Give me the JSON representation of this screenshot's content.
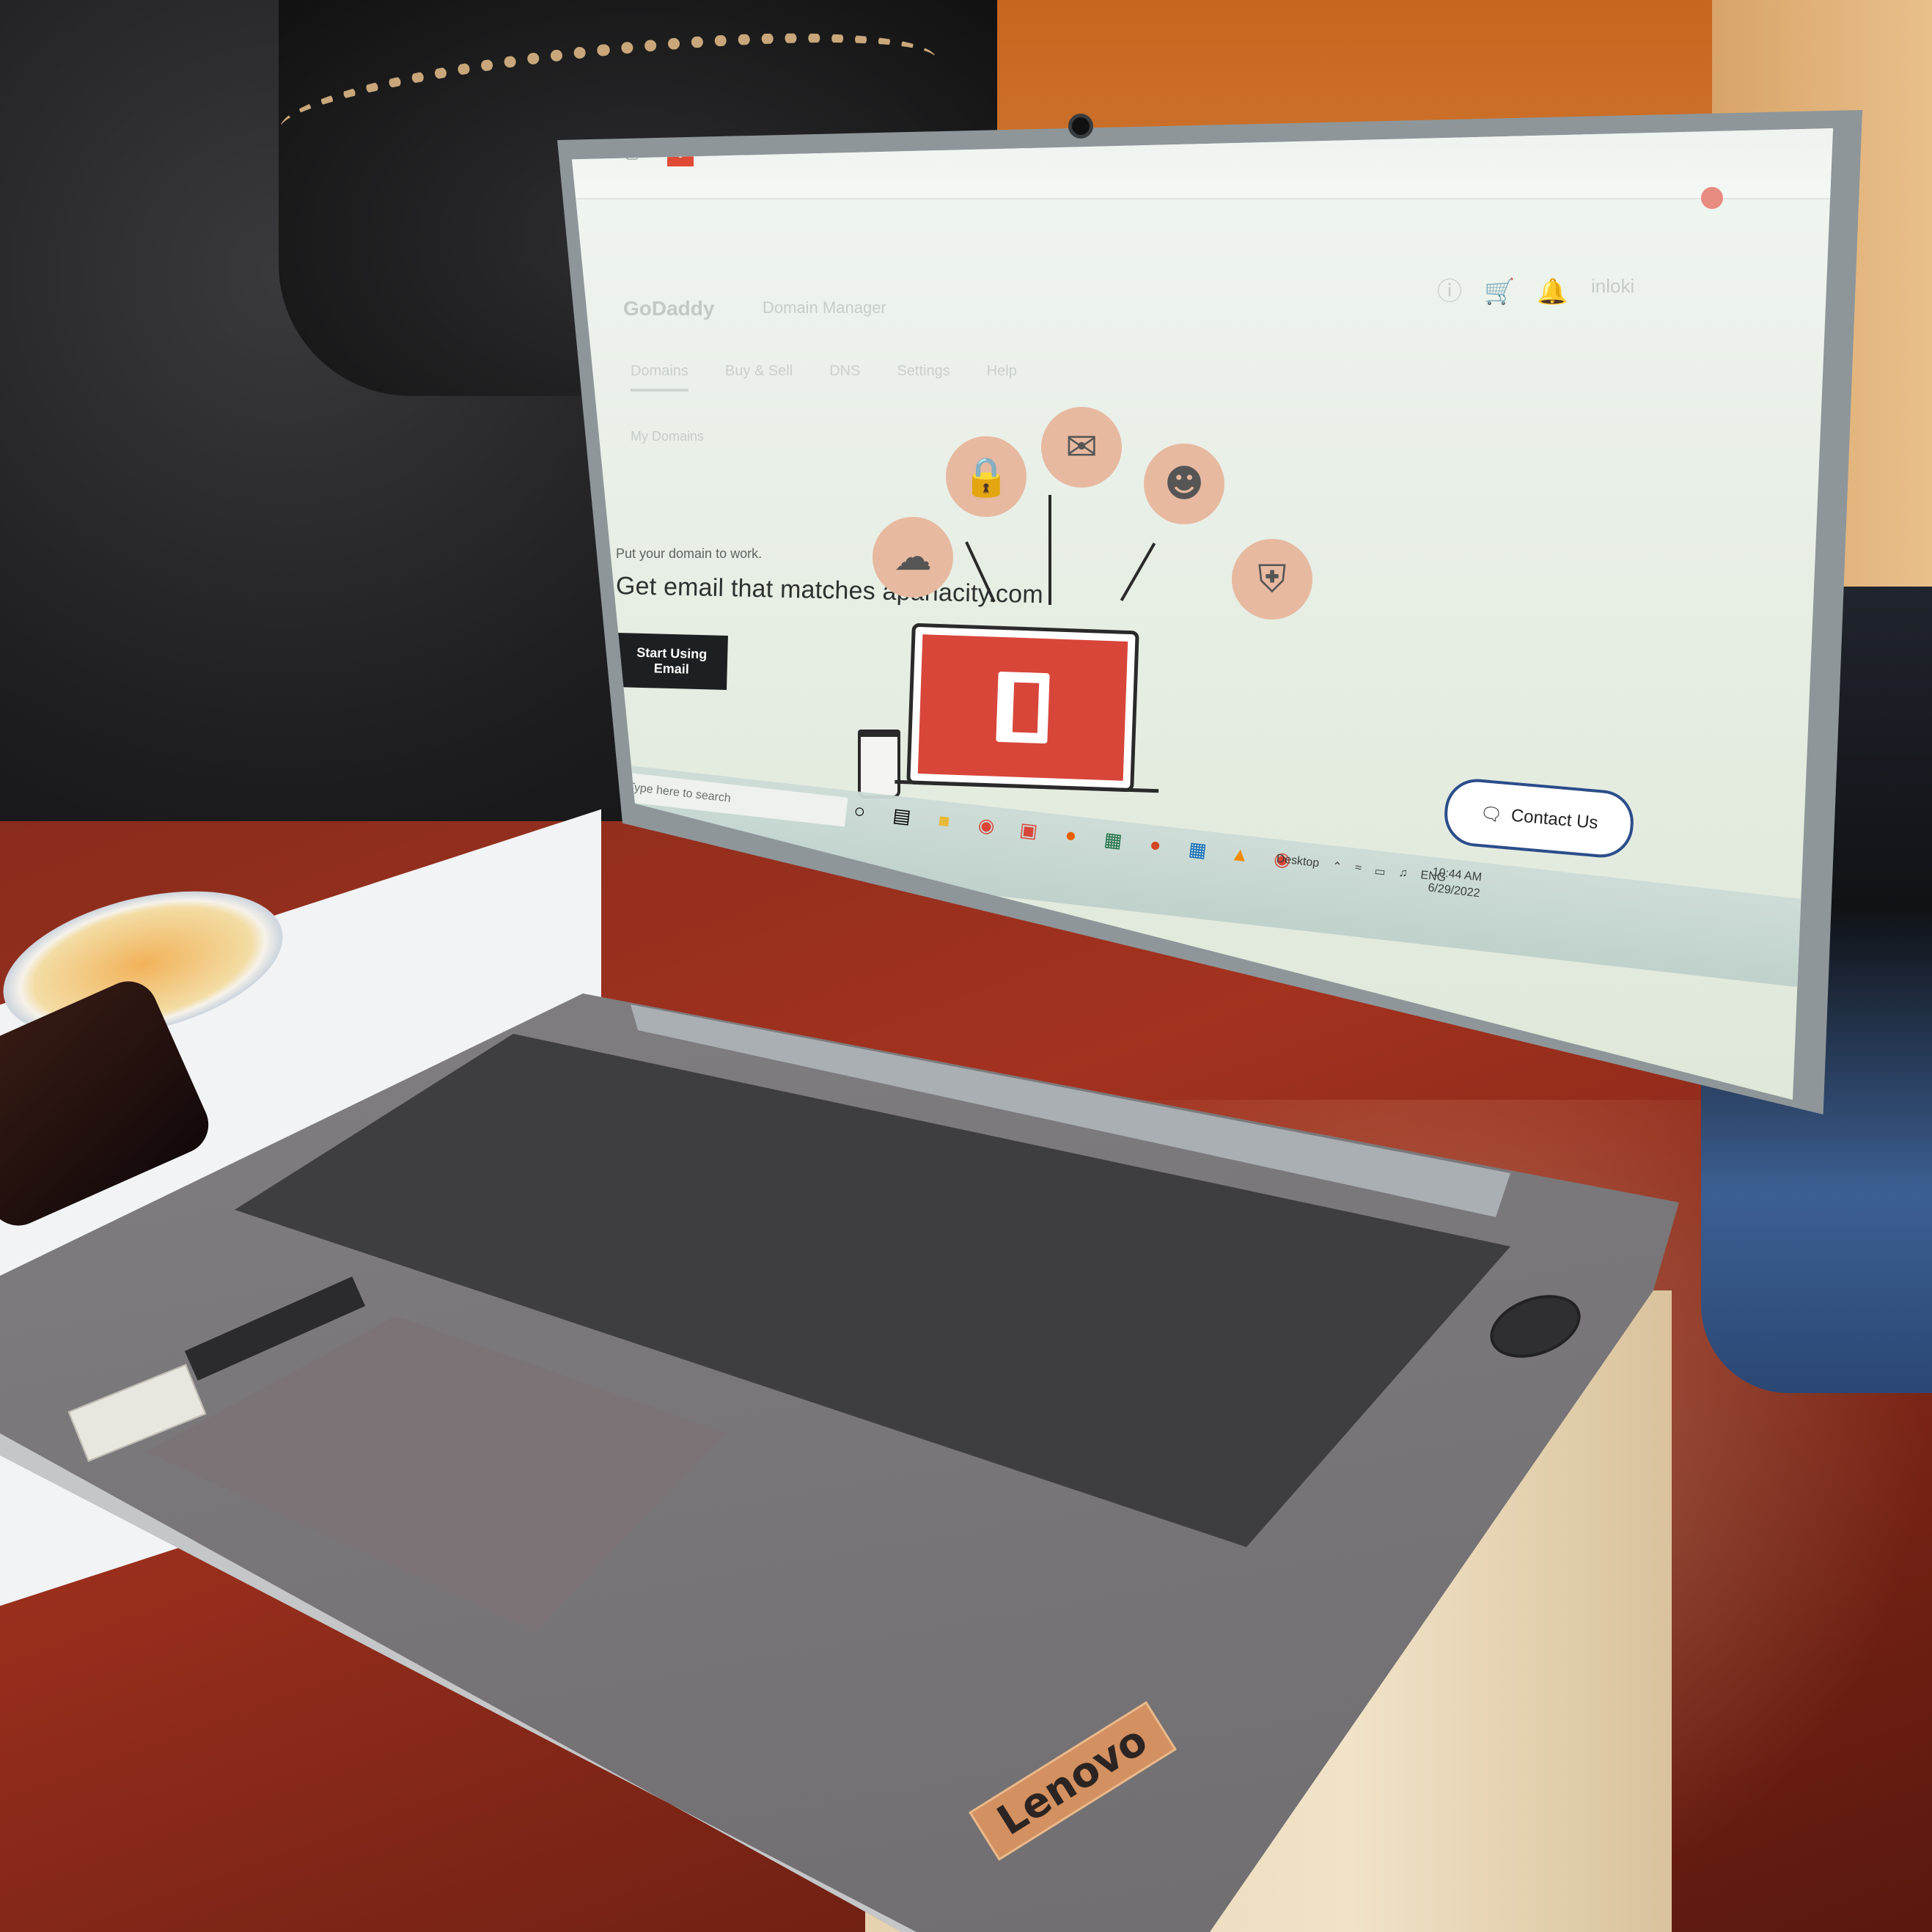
{
  "browser": {
    "ext_icons": "☰ •→ ▢"
  },
  "site": {
    "brand": "GoDaddy",
    "section": "Domain Manager",
    "user": "inloki",
    "nav": [
      "Domains",
      "Buy & Sell",
      "DNS",
      "Settings",
      "Help"
    ],
    "crumb": "My Domains"
  },
  "promo": {
    "eyebrow": "Put your domain to work.",
    "headline": "Get email that matches apanacity.com",
    "cta_label": "Start Using Email",
    "contact_label": "Contact Us",
    "icons": [
      "cloud-icon",
      "lock-icon",
      "mail-icon",
      "people-icon",
      "shield-icon"
    ]
  },
  "taskbar": {
    "search_placeholder": "Type here to search",
    "desktop_label": "Desktop",
    "language": "ENG",
    "time": "10:44 AM",
    "date": "6/29/2022"
  },
  "laptop": {
    "brand": "Lenovo"
  },
  "colors": {
    "office_red": "#d8463a",
    "contact_border": "#2b4d8a",
    "cta_bg": "#1d2022"
  }
}
